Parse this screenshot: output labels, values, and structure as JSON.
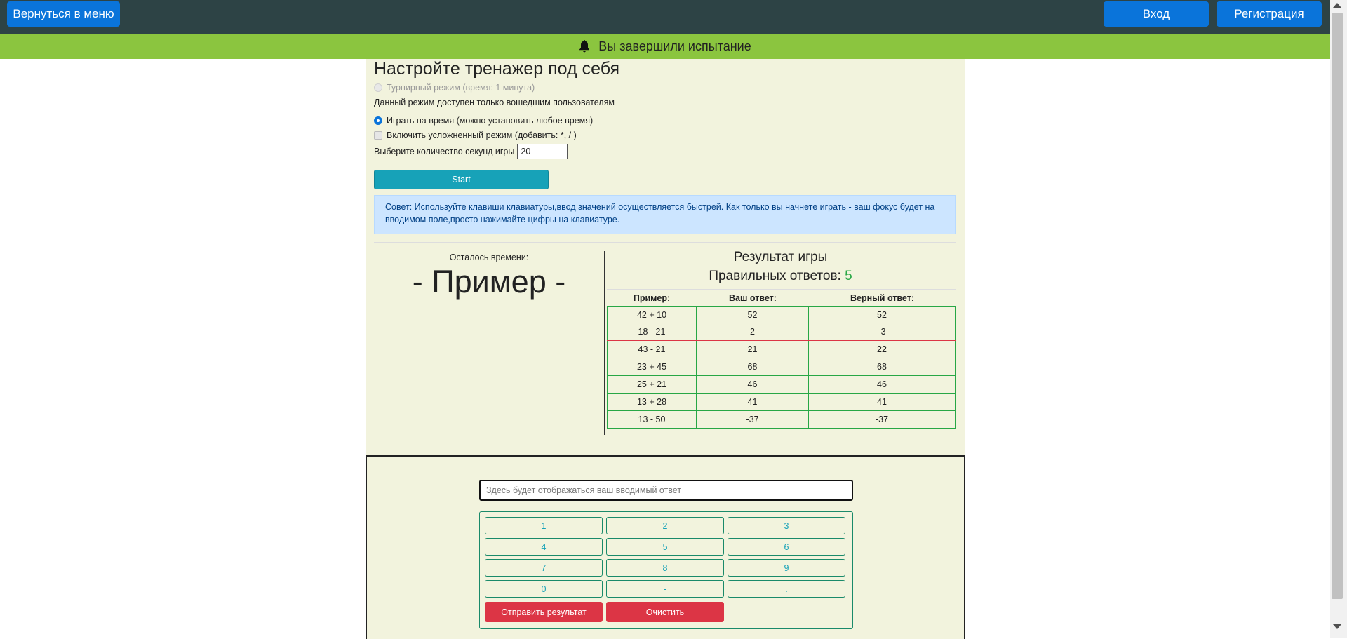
{
  "header": {
    "back_button": "Вернуться в меню",
    "login_button": "Вход",
    "register_button": "Регистрация"
  },
  "notification": {
    "icon": "bell-icon",
    "text": "Вы завершили испытание"
  },
  "settings": {
    "title": "Настройте тренажер под себя",
    "tournament_mode": "Турнирный режим (время: 1 минута)",
    "tournament_note": "Данный режим доступен только вошедшим пользователям",
    "timed_mode": "Играть на время (можно установить любое время)",
    "hard_mode": "Включить усложненный режим (добавить: *, / )",
    "seconds_label": "Выберите количество секунд игры",
    "seconds_value": "20",
    "start_button": "Start",
    "tip": "Совет: Используйте клавиши клавиатуры,ввод значений осуществляется быстрей. Как только вы начнете играть - ваш фокус будет на вводимом поле,просто нажимайте цифры на клавиатуре."
  },
  "game": {
    "time_left_label": "Осталось времени:",
    "example": "- Пример -",
    "result_title": "Результат игры",
    "correct_label": "Правильных ответов:",
    "correct_count": "5"
  },
  "results_table": {
    "headers": [
      "Пример:",
      "Ваш ответ:",
      "Верный ответ:"
    ],
    "rows": [
      {
        "example": "42 + 10",
        "answer": "52",
        "correct": "52",
        "status": "correct"
      },
      {
        "example": "18 - 21",
        "answer": "2",
        "correct": "-3",
        "status": "wrong"
      },
      {
        "example": "43 - 21",
        "answer": "21",
        "correct": "22",
        "status": "wrong"
      },
      {
        "example": "23 + 45",
        "answer": "68",
        "correct": "68",
        "status": "correct"
      },
      {
        "example": "25 + 21",
        "answer": "46",
        "correct": "46",
        "status": "correct"
      },
      {
        "example": "13 + 28",
        "answer": "41",
        "correct": "41",
        "status": "correct"
      },
      {
        "example": "13 - 50",
        "answer": "-37",
        "correct": "-37",
        "status": "correct"
      }
    ]
  },
  "input_panel": {
    "answer_placeholder": "Здесь будет отображаться ваш вводимый ответ",
    "keys": [
      "1",
      "2",
      "3",
      "4",
      "5",
      "6",
      "7",
      "8",
      "9",
      "0",
      "-",
      "."
    ],
    "submit_button": "Отправить результат",
    "clear_button": "Очистить"
  },
  "colors": {
    "navbar": "#2d4345",
    "notification": "#8bc53f",
    "panel": "#f2f3dd",
    "primary": "#0a74da",
    "info": "#17a2b8",
    "danger": "#dc3545",
    "success": "#28a745"
  }
}
